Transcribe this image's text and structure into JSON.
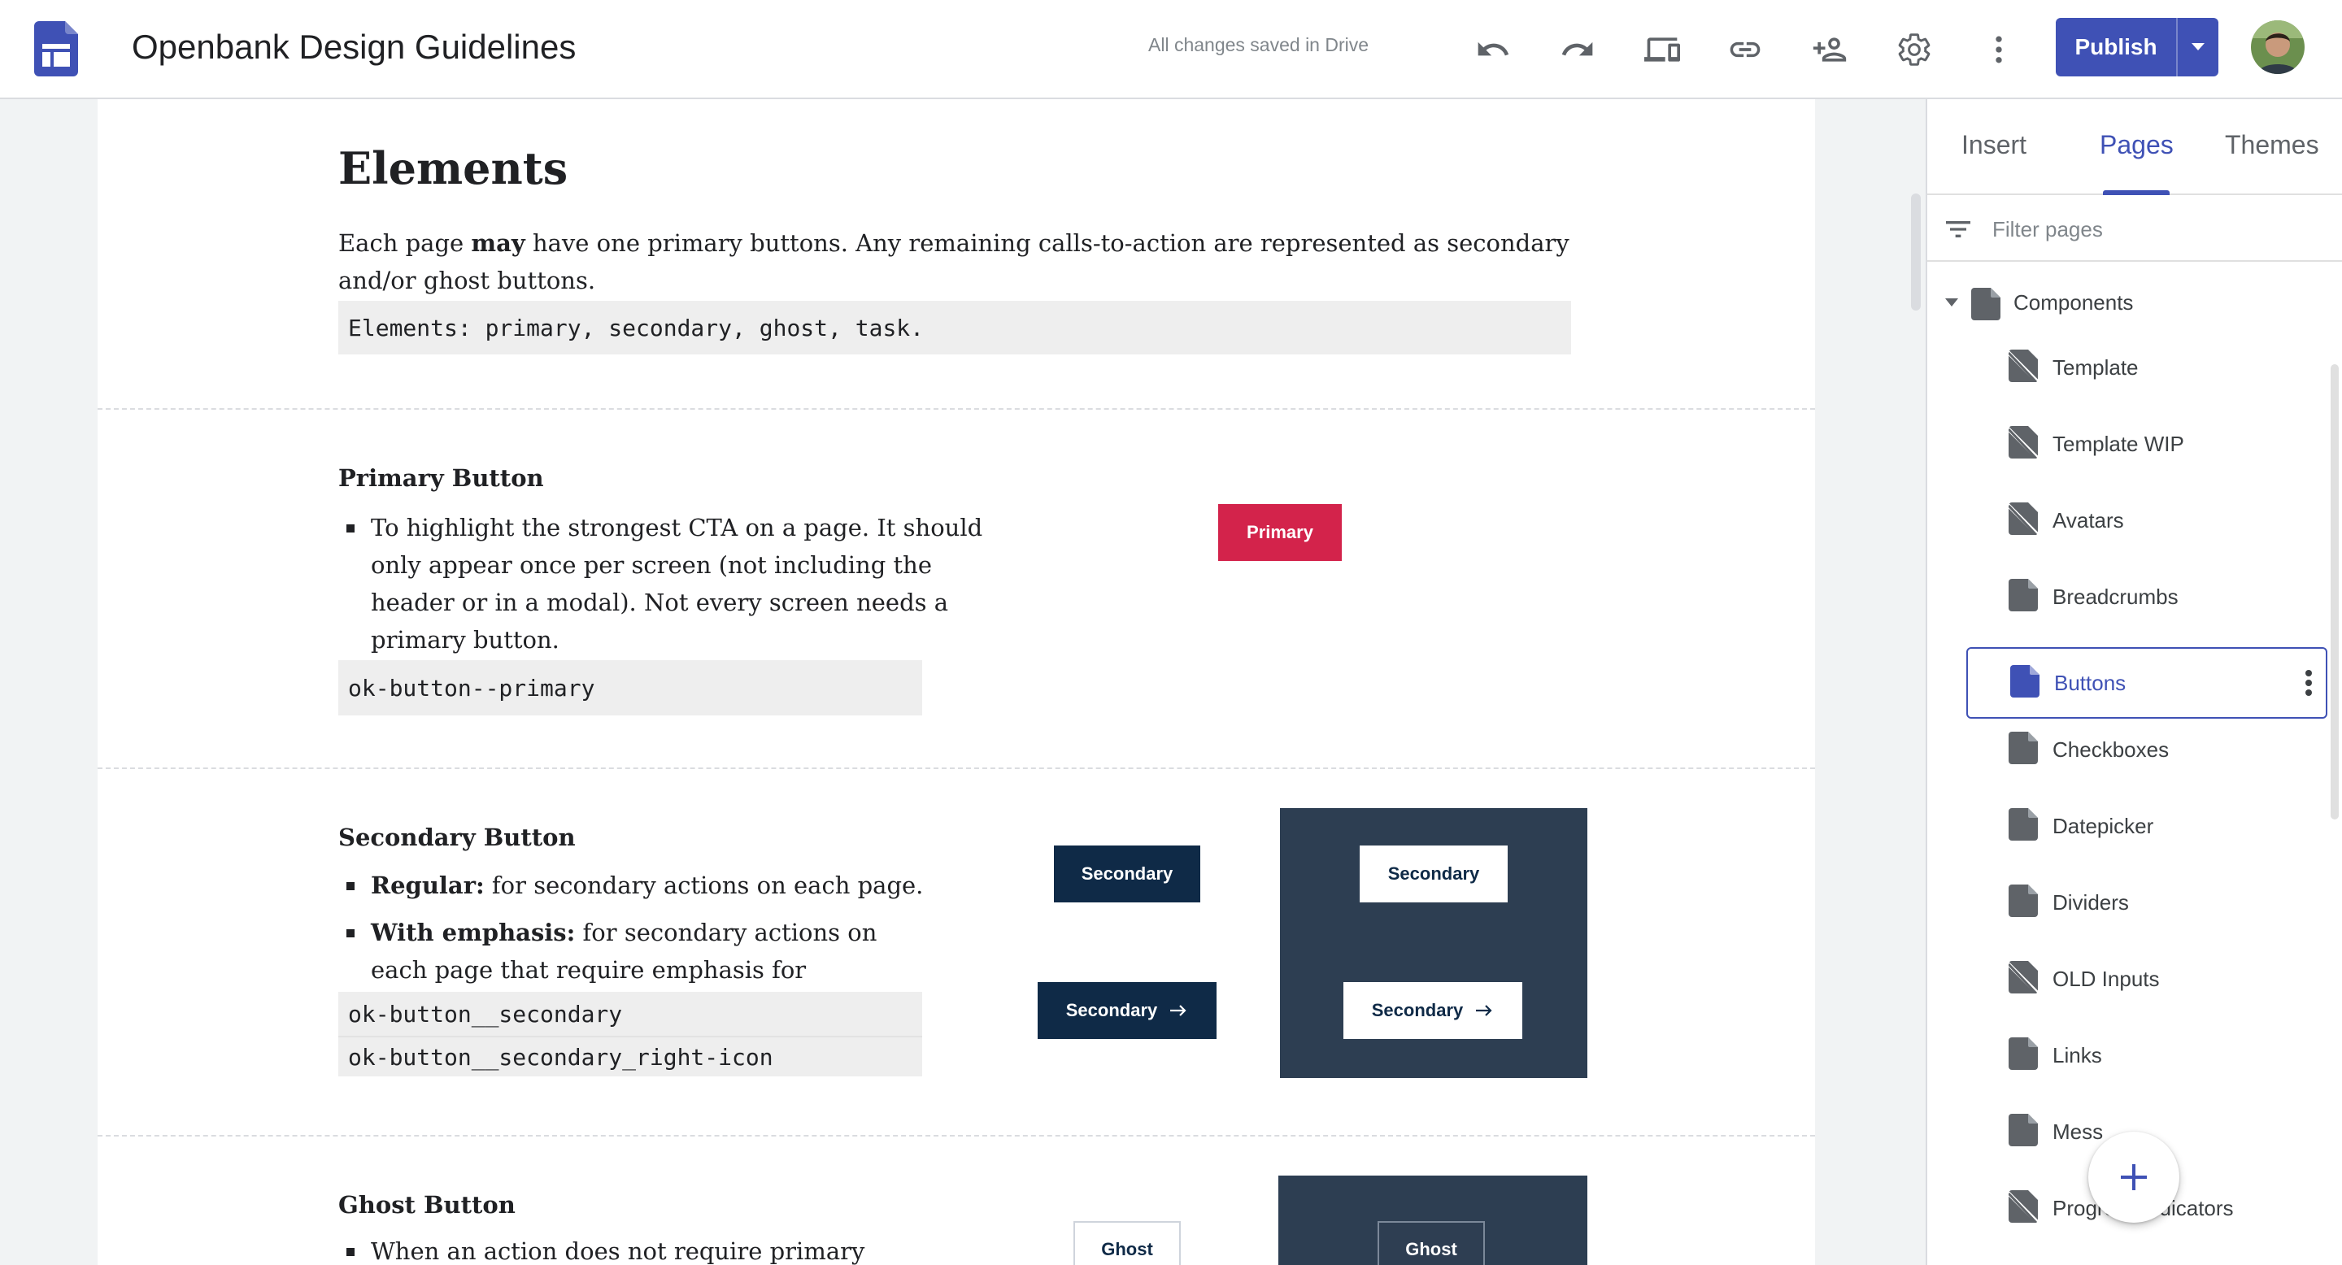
{
  "topbar": {
    "title": "Openbank Design Guidelines",
    "save_status": "All changes saved in Drive",
    "publish_label": "Publish",
    "icons": [
      "undo-icon",
      "redo-icon",
      "preview-devices-icon",
      "link-icon",
      "share-icon",
      "settings-icon",
      "more-vert-icon"
    ]
  },
  "content": {
    "elements": {
      "heading": "Elements",
      "text_pre": "Each page ",
      "text_bold": "may",
      "text_post": " have one primary buttons. Any remaining calls-to-action are represented as secondary and/or ghost buttons.",
      "code": "Elements: primary, secondary, ghost, task."
    },
    "primary": {
      "heading": "Primary Button",
      "bullet": "To highlight the strongest CTA on a page. It should only appear once per screen (not including the header or in a modal). Not every screen needs a primary button.",
      "code": "ok-button--primary",
      "demo_label": "Primary"
    },
    "secondary": {
      "heading": "Secondary Button",
      "bullet1_bold": "Regular:",
      "bullet1_text": " for secondary actions on each page.",
      "bullet2_bold": "With emphasis:",
      "bullet2_text": " for secondary actions on each page that require emphasis for conversion.",
      "code1": "ok-button__secondary",
      "code2": "ok-button__secondary_right-icon",
      "demo_label": "Secondary"
    },
    "ghost": {
      "heading": "Ghost Button",
      "bullet": "When an action does not require primary",
      "demo_label": "Ghost"
    }
  },
  "sidebar": {
    "tabs": [
      {
        "label": "Insert",
        "active": false
      },
      {
        "label": "Pages",
        "active": true
      },
      {
        "label": "Themes",
        "active": false
      }
    ],
    "filter_placeholder": "Filter pages",
    "root": "Components",
    "pages": [
      {
        "label": "Template",
        "hidden": true
      },
      {
        "label": "Template WIP",
        "hidden": true
      },
      {
        "label": "Avatars",
        "hidden": true
      },
      {
        "label": "Breadcrumbs",
        "hidden": false
      },
      {
        "label": "Buttons",
        "hidden": false,
        "selected": true
      },
      {
        "label": "Checkboxes",
        "hidden": false
      },
      {
        "label": "Datepicker",
        "hidden": false
      },
      {
        "label": "Dividers",
        "hidden": false
      },
      {
        "label": "OLD Inputs",
        "hidden": true
      },
      {
        "label": "Links",
        "hidden": false
      },
      {
        "label": "Mess",
        "hidden": false
      },
      {
        "label": "Progress indicators",
        "hidden": true
      }
    ]
  },
  "colors": {
    "accent": "#3f51b5",
    "primary_button": "#d3234b",
    "secondary_button": "#0f2a47",
    "dark_panel": "#2d3e52"
  }
}
